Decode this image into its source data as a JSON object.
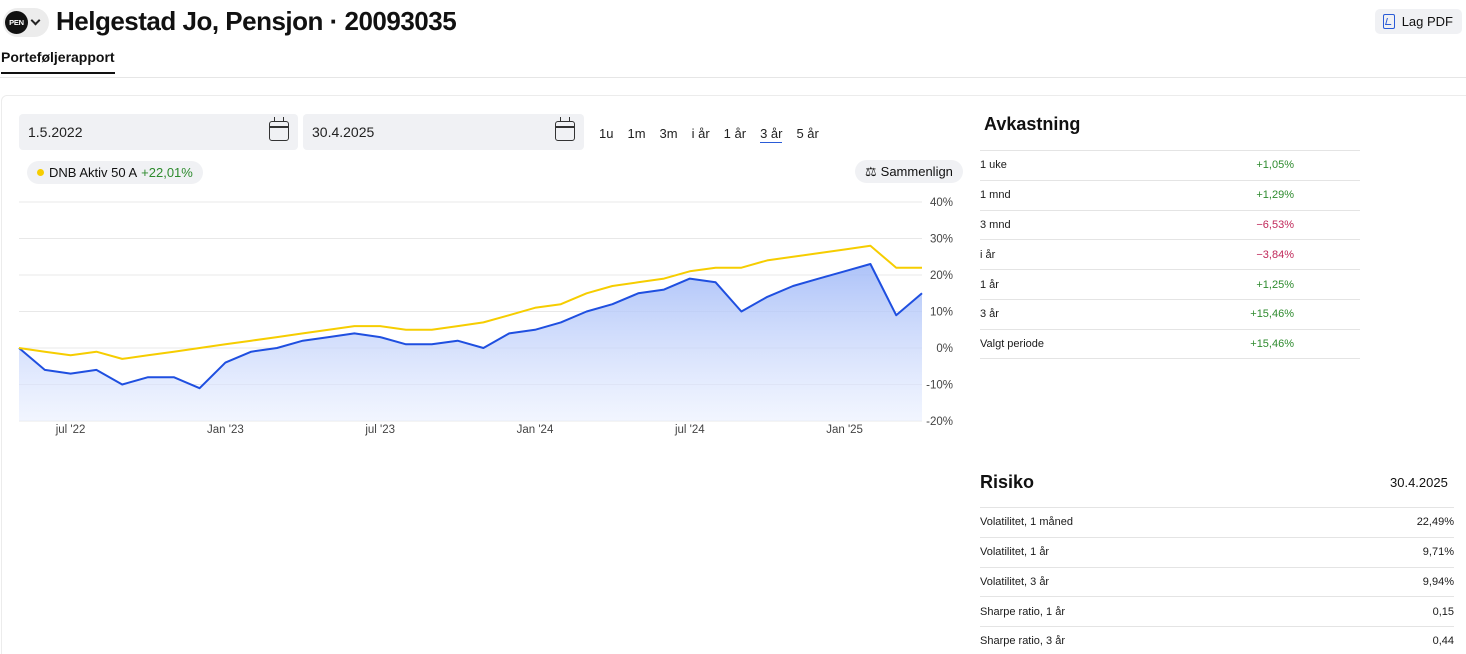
{
  "header": {
    "account_badge": "PEN",
    "title": "Helgestad Jo, Pensjon · 20093035",
    "pdf_label": "Lag PDF"
  },
  "tabs": [
    {
      "label": "Porteføljerapport",
      "active": true
    }
  ],
  "filters": {
    "from_date": "1.5.2022",
    "to_date": "30.4.2025",
    "periods": [
      "1u",
      "1m",
      "3m",
      "i år",
      "1 år",
      "3 år",
      "5 år"
    ],
    "active_period": "3 år"
  },
  "legend": {
    "name": "DNB Aktiv 50 A",
    "value": "+22,01%",
    "color": "#f6cd00"
  },
  "compare_label": "Sammenlign",
  "colors": {
    "fund": "#f6cd00",
    "portfolio": "#1f4fe0",
    "positive": "#2e8b2e",
    "negative": "#c0285a"
  },
  "chart_data": {
    "type": "line",
    "x": [
      "2022-05",
      "2022-06",
      "2022-07",
      "2022-08",
      "2022-09",
      "2022-10",
      "2022-11",
      "2022-12",
      "2023-01",
      "2023-02",
      "2023-03",
      "2023-04",
      "2023-05",
      "2023-06",
      "2023-07",
      "2023-08",
      "2023-09",
      "2023-10",
      "2023-11",
      "2023-12",
      "2024-01",
      "2024-02",
      "2024-03",
      "2024-04",
      "2024-05",
      "2024-06",
      "2024-07",
      "2024-08",
      "2024-09",
      "2024-10",
      "2024-11",
      "2024-12",
      "2025-01",
      "2025-02",
      "2025-03",
      "2025-04"
    ],
    "x_ticks": [
      "jul '22",
      "Jan '23",
      "jul '23",
      "Jan '24",
      "jul '24",
      "Jan '25"
    ],
    "y_ticks": [
      "40%",
      "30%",
      "20%",
      "10%",
      "0%",
      "-10%",
      "-20%"
    ],
    "ylim": [
      -20,
      40
    ],
    "series": [
      {
        "name": "DNB Aktiv 50 A",
        "color": "#f6cd00",
        "values": [
          0,
          -1,
          -2,
          -1,
          -3,
          -2,
          -1,
          0,
          1,
          2,
          3,
          4,
          5,
          6,
          6,
          5,
          5,
          6,
          7,
          9,
          11,
          12,
          15,
          17,
          18,
          19,
          21,
          22,
          22,
          24,
          25,
          26,
          27,
          28,
          22,
          22
        ]
      },
      {
        "name": "",
        "color": "#1f4fe0",
        "values": [
          0,
          -6,
          -7,
          -6,
          -10,
          -8,
          -8,
          -11,
          -4,
          -1,
          0,
          2,
          3,
          4,
          3,
          1,
          1,
          2,
          0,
          4,
          5,
          7,
          10,
          12,
          15,
          16,
          19,
          18,
          10,
          14,
          17,
          19,
          21,
          23,
          9,
          15
        ]
      }
    ]
  },
  "returns": {
    "title": "Avkastning",
    "rows": [
      {
        "label": "1 uke",
        "value": "+1,05%",
        "sign": "pos"
      },
      {
        "label": "1 mnd",
        "value": "+1,29%",
        "sign": "pos"
      },
      {
        "label": "3 mnd",
        "value": "−6,53%",
        "sign": "neg"
      },
      {
        "label": "i år",
        "value": "−3,84%",
        "sign": "neg"
      },
      {
        "label": "1 år",
        "value": "+1,25%",
        "sign": "pos"
      },
      {
        "label": "3 år",
        "value": "+15,46%",
        "sign": "pos"
      },
      {
        "label": "Valgt periode",
        "value": "+15,46%",
        "sign": "pos"
      }
    ]
  },
  "risk": {
    "title": "Risiko",
    "date": "30.4.2025",
    "rows": [
      {
        "label": "Volatilitet, 1 måned",
        "value": "22,49%"
      },
      {
        "label": "Volatilitet, 1 år",
        "value": "9,71%"
      },
      {
        "label": "Volatilitet, 3 år",
        "value": "9,94%"
      },
      {
        "label": "Sharpe ratio, 1 år",
        "value": "0,15"
      },
      {
        "label": "Sharpe ratio, 3 år",
        "value": "0,44"
      }
    ]
  }
}
